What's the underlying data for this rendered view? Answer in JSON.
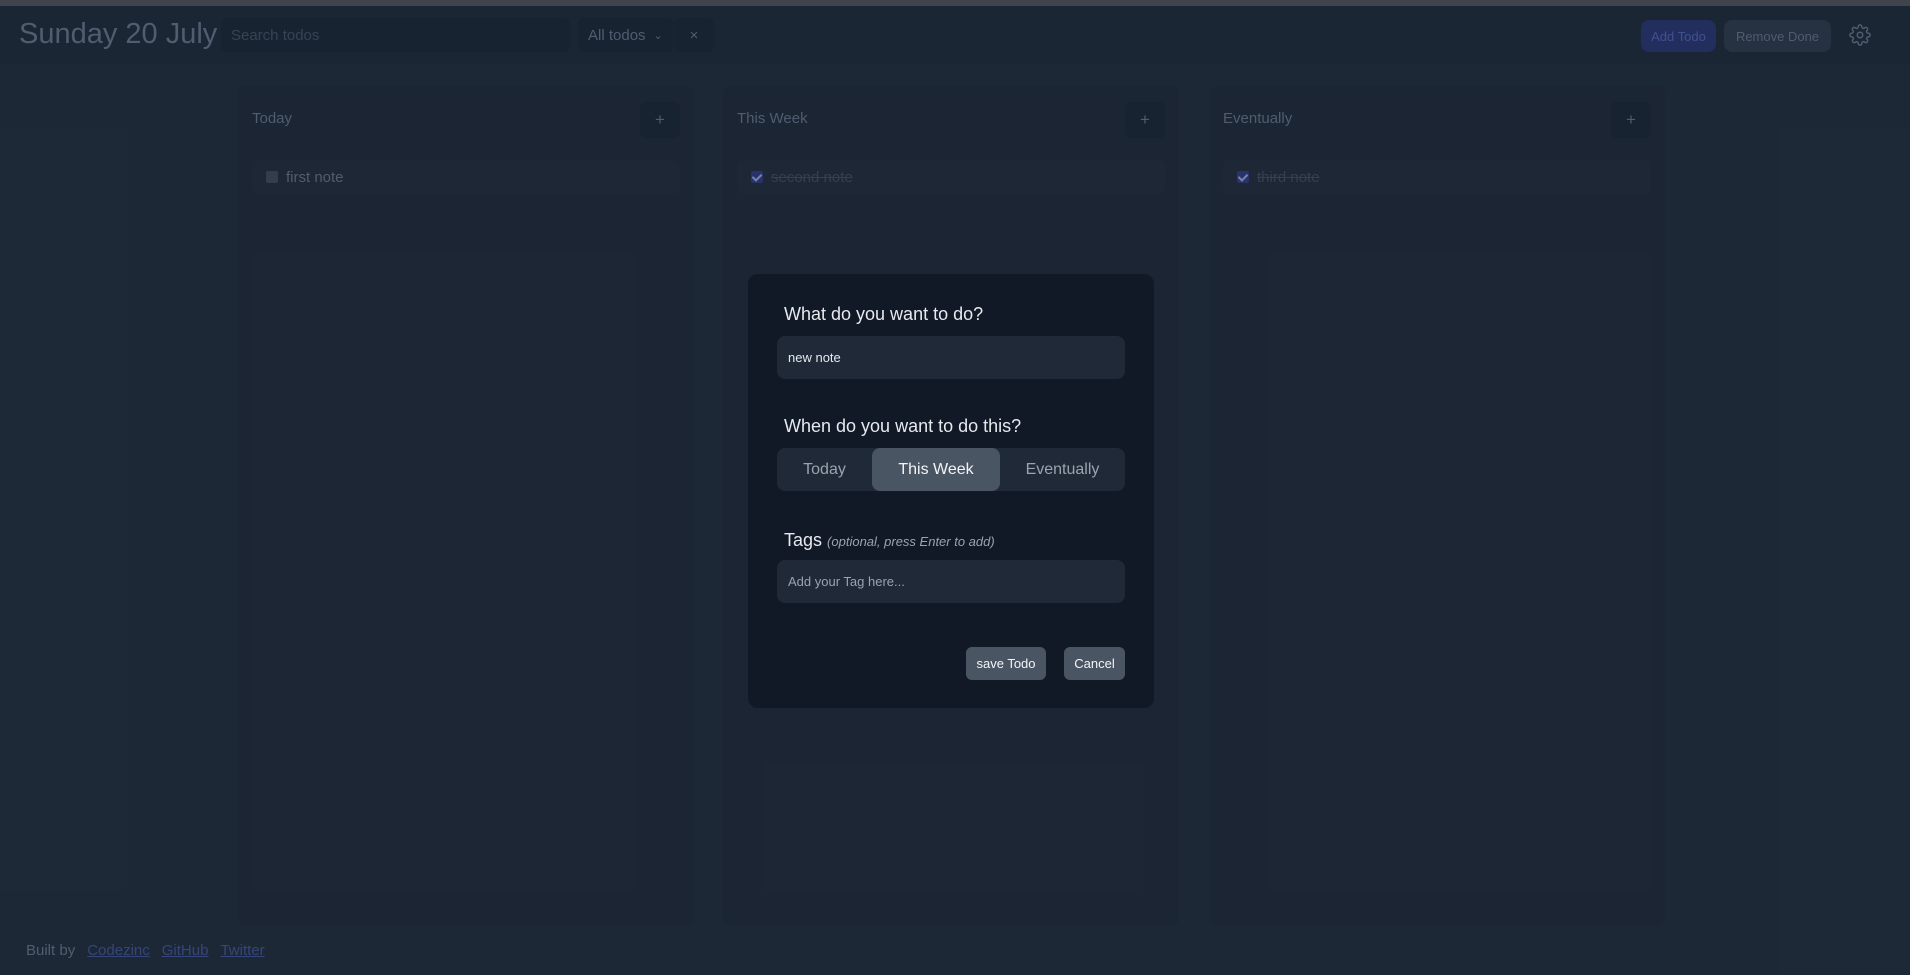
{
  "header": {
    "date_title": "Sunday 20 July",
    "search_placeholder": "Search todos",
    "filter_label": "All todos",
    "clear_label": "×",
    "add_todo_label": "Add Todo",
    "remove_done_label": "Remove Done",
    "settings_icon": "gear-icon"
  },
  "columns": [
    {
      "title": "Today",
      "add_label": "+",
      "todos": [
        {
          "text": "first note",
          "done": false
        }
      ]
    },
    {
      "title": "This Week",
      "add_label": "+",
      "todos": [
        {
          "text": "second note",
          "done": true
        }
      ]
    },
    {
      "title": "Eventually",
      "add_label": "+",
      "todos": [
        {
          "text": "third note",
          "done": true
        }
      ]
    }
  ],
  "modal": {
    "what_label": "What do you want to do?",
    "todo_value": "new note",
    "when_label": "When do you want to do this?",
    "when_options": [
      "Today",
      "This Week",
      "Eventually"
    ],
    "when_selected": "This Week",
    "tags_label": "Tags",
    "tags_hint": "(optional, press Enter to add)",
    "tags_placeholder": "Add your Tag here...",
    "save_label": "save Todo",
    "cancel_label": "Cancel"
  },
  "footer": {
    "built_by": "Built by",
    "links": [
      "Codezinc",
      "GitHub",
      "Twitter"
    ]
  }
}
